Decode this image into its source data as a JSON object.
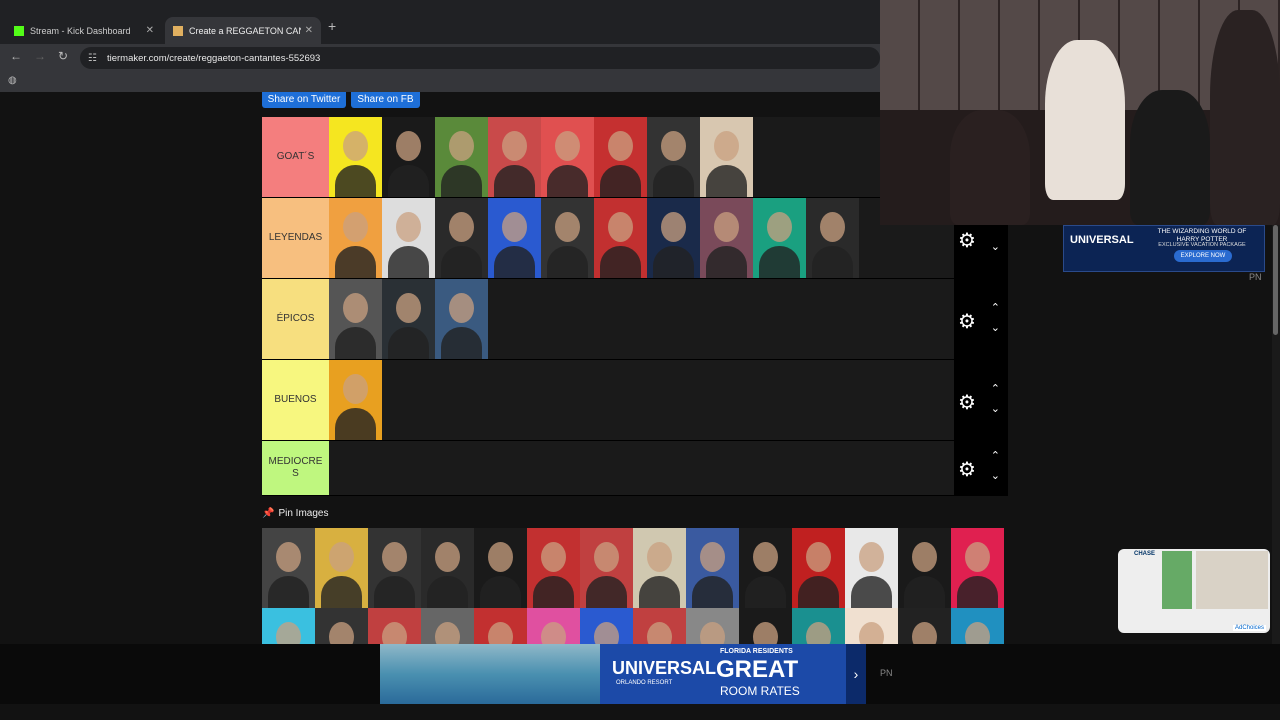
{
  "browser": {
    "tabs": [
      {
        "title": "Stream - Kick Dashboard",
        "favicon_color": "#53fc18"
      },
      {
        "title": "Create a REGGAETON CANTANTES",
        "favicon_color": "#e0b060"
      }
    ],
    "url": "tiermaker.com/create/reggaeton-cantantes-552693"
  },
  "share": {
    "twitter": "Share on Twitter",
    "fb": "Share on FB"
  },
  "tiers": [
    {
      "label": "GOAT´S",
      "color": "#f47e7e",
      "count": 8,
      "thumb_colors": [
        "#f5e620",
        "#1a1a1a",
        "#5a8a3a",
        "#c94a4a",
        "#e05050",
        "#c53030",
        "#333333",
        "#d8c7b0"
      ]
    },
    {
      "label": "LEYENDAS",
      "color": "#f7bf7f",
      "count": 10,
      "thumb_colors": [
        "#f0a040",
        "#ddd",
        "#2a2a2a",
        "#2a5ad0",
        "#333",
        "#c23030",
        "#1a2a4a",
        "#7a4a5a",
        "#1aa080",
        "#2a2a2a"
      ]
    },
    {
      "label": "ÉPICOS",
      "color": "#f7df7f",
      "count": 3,
      "thumb_colors": [
        "#555",
        "#2a3035",
        "#3a5a80"
      ]
    },
    {
      "label": "BUENOS",
      "color": "#f7f77f",
      "count": 1,
      "thumb_colors": [
        "#e8a020"
      ]
    },
    {
      "label": "MEDIOCRES",
      "label_display": "MEDIOCRE\nS",
      "color": "#bff77f",
      "count": 0,
      "thumb_colors": []
    }
  ],
  "pin": {
    "label": "Pin Images"
  },
  "pin_thumb_colors": [
    "#444",
    "#d8b040",
    "#333",
    "#2a2a2a",
    "#1a1a1a",
    "#c23030",
    "#c04040",
    "#d0c8b0",
    "#3a5aa0",
    "#1a1a1a",
    "#c02020",
    "#e8e8e8",
    "#1a1a1a",
    "#e02050",
    "#3ac0e0",
    "#333",
    "#c04040",
    "#666",
    "#c23030",
    "#e050a0",
    "#2a5ad0",
    "#c04040",
    "#888",
    "#1a1a1a",
    "#1a9090",
    "#f0e0d0",
    "#222",
    "#2090c0"
  ],
  "ads": {
    "side": {
      "brand": "UNIVERSAL",
      "headline": "THE WIZARDING WORLD OF HARRY POTTER",
      "sub": "EXCLUSIVE VACATION PACKAGE",
      "cta": "EXPLORE NOW"
    },
    "chase": {
      "brand": "CHASE",
      "choices": "AdChoices"
    },
    "bottom": {
      "brand": "UNIVERSAL",
      "brand_sub": "ORLANDO RESORT",
      "eyebrow": "FLORIDA RESIDENTS",
      "headline": "GREAT",
      "sub": "ROOM RATES"
    },
    "pn": "PN"
  }
}
